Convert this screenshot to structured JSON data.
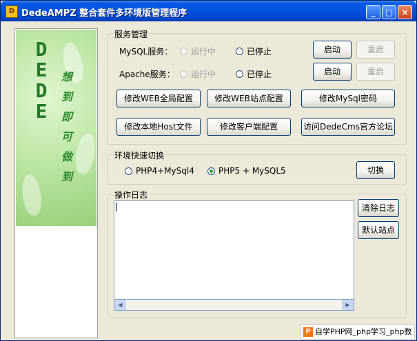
{
  "window": {
    "title": "DedeAMPZ 整合套件多环境版管理程序",
    "minimize_glyph": "_",
    "maximize_glyph": "□",
    "close_glyph": "×"
  },
  "sidebar": {
    "brand_letters": [
      "D",
      "E",
      "D",
      "E"
    ],
    "slogan_chars": [
      "想",
      "到",
      "即",
      "可",
      "做",
      "到"
    ]
  },
  "service": {
    "title": "服务管理",
    "mysql_label": "MySQL服务：",
    "apache_label": "Apache服务：",
    "running_label": "运行中",
    "stopped_label": "已停止",
    "start_label": "启动",
    "restart_label": "重启",
    "buttons": [
      "修改WEB全局配置",
      "修改WEB站点配置",
      "修改MySql密码",
      "修改本地Host文件",
      "修改客户端配置",
      "访问DedeCms官方论坛"
    ]
  },
  "env": {
    "title": "环境快速切换",
    "option1": "PHP4+MySql4",
    "option2": "PHP5 + MySQL5",
    "switch_label": "切换"
  },
  "log": {
    "title": "操作日志",
    "clear_label": "清除日志",
    "default_site_label": "默认站点"
  },
  "watermark": {
    "icon": "P",
    "text": "自学PHP网_php学习_php教"
  }
}
